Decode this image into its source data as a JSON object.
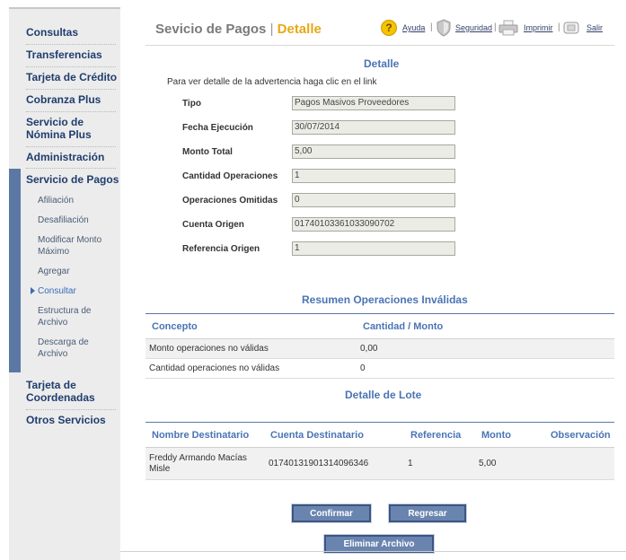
{
  "sidebar": {
    "items": [
      {
        "label": "Consultas"
      },
      {
        "label": "Transferencias"
      },
      {
        "label": "Tarjeta de Crédito"
      },
      {
        "label": "Cobranza Plus"
      },
      {
        "label": "Servicio de Nómina Plus"
      },
      {
        "label": "Administración"
      },
      {
        "label": "Servicio de Pagos"
      },
      {
        "label": "Tarjeta de Coordenadas"
      },
      {
        "label": "Otros Servicios"
      }
    ],
    "sub_items": [
      {
        "label": "Afiliación"
      },
      {
        "label": "Desafiliación"
      },
      {
        "label": "Modificar Monto Máximo"
      },
      {
        "label": "Agregar"
      },
      {
        "label": "Consultar"
      },
      {
        "label": "Estructura de Archivo"
      },
      {
        "label": "Descarga de Archivo"
      }
    ],
    "active_item": "Servicio de Pagos",
    "current_sub_item": "Consultar"
  },
  "header": {
    "title": "Sevicio de Pagos",
    "separator": "|",
    "subtitle": "Detalle",
    "links": {
      "help": "Ayuda",
      "security": "Seguridad",
      "print": "Imprimir",
      "exit": "Salir",
      "separator": "|"
    }
  },
  "detail": {
    "title": "Detalle",
    "intro": "Para ver detalle de la advertencia haga clic en el link",
    "fields": [
      {
        "label": "Tipo",
        "value": "Pagos Masivos Proveedores"
      },
      {
        "label": "Fecha Ejecución",
        "value": "30/07/2014"
      },
      {
        "label": "Monto Total",
        "value": "5,00"
      },
      {
        "label": "Cantidad Operaciones",
        "value": "1"
      },
      {
        "label": "Operaciones Omitidas",
        "value": "0"
      },
      {
        "label": "Cuenta Origen",
        "value": "01740103361033090702"
      },
      {
        "label": "Referencia Origen",
        "value": "1"
      }
    ]
  },
  "invalid_summary": {
    "title": "Resumen Operaciones Inválidas",
    "headers": [
      "Concepto",
      "Cantidad / Monto"
    ],
    "rows": [
      [
        "Monto operaciones no válidas",
        "0,00"
      ],
      [
        "Cantidad operaciones no válidas",
        "0"
      ]
    ]
  },
  "batch_detail": {
    "title": "Detalle de Lote",
    "headers": [
      "Nombre Destinatario",
      "Cuenta Destinatario",
      "Referencia",
      "Monto",
      "Observación"
    ],
    "rows": [
      {
        "name_line1": "Freddy Armando Macías",
        "name_line2": "Misle",
        "account": "01740131901314096346",
        "reference": "1",
        "amount": "5,00",
        "observation": ""
      }
    ]
  },
  "buttons": {
    "confirm": "Confirmar",
    "back": "Regresar",
    "delete_file": "Eliminar Archivo"
  },
  "colors": {
    "accent": "#e6a817",
    "link_blue": "#4a74b4",
    "nav_blue": "#1f3d6e",
    "button_blue": "#6a84b0"
  }
}
